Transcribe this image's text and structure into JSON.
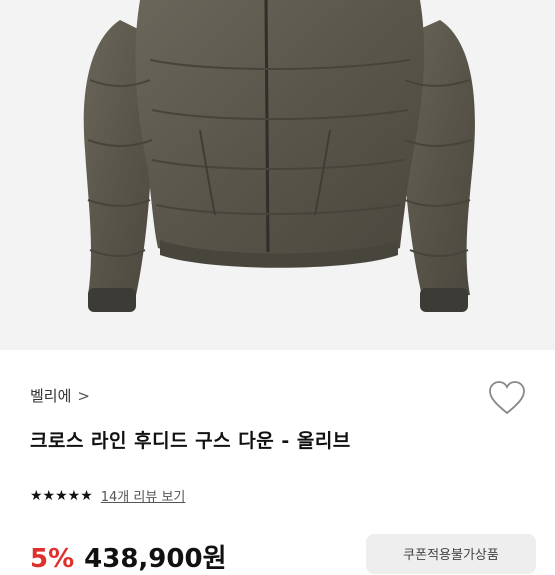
{
  "product": {
    "brand": "벨리에",
    "brand_chevron": ">",
    "title": "크로스 라인 후디드 구스 다운 - 올리브",
    "rating_stars": "★★★★★",
    "review_link": "14개 리뷰 보기",
    "discount": "5%",
    "price": "438,900원",
    "coupon_label": "쿠폰적용불가상품",
    "image_icon": "puffer-jacket-image",
    "wishlist_icon": "heart-outline-icon"
  },
  "colors": {
    "accent_red": "#e0302c",
    "jacket": "#5b574c"
  }
}
